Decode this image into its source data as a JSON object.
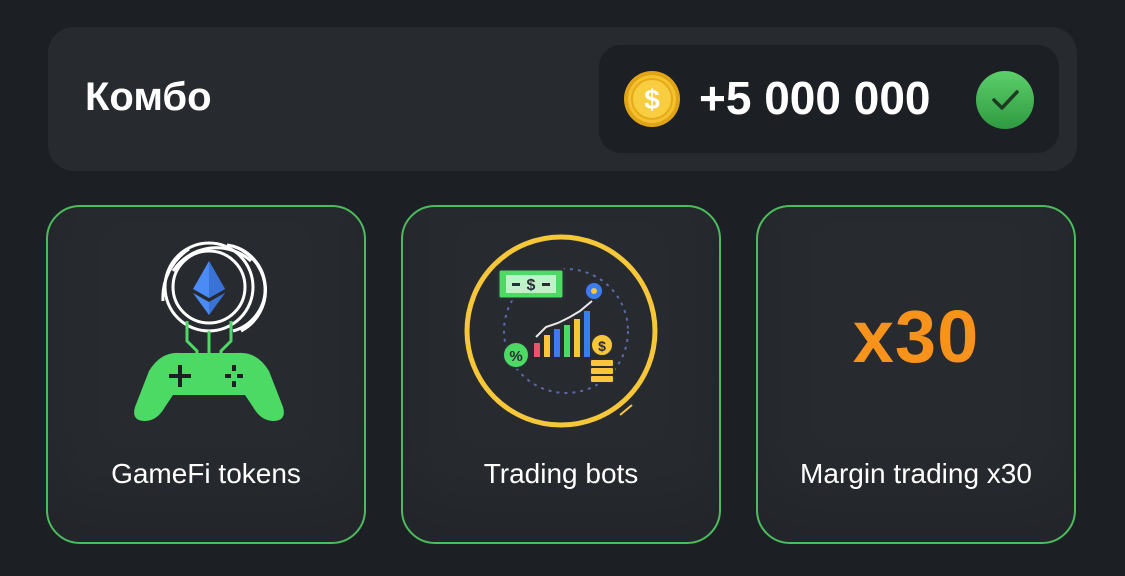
{
  "combo": {
    "title": "Комбо",
    "reward": "+5 000 000",
    "icons": [
      "coin-icon",
      "check-icon"
    ]
  },
  "cards": [
    {
      "label": "GameFi tokens",
      "icon": "gamefi-controller-icon"
    },
    {
      "label": "Trading bots",
      "icon": "trading-bots-icon"
    },
    {
      "label": "Margin trading x30",
      "icon_text": "x30"
    }
  ],
  "colors": {
    "background": "#1c1f24",
    "panel": "#272a2f",
    "card_border": "#4cbb5c",
    "accent_orange": "#f7931a",
    "coin_gold": "#f5c12e",
    "check_green": "#3fae4e"
  }
}
